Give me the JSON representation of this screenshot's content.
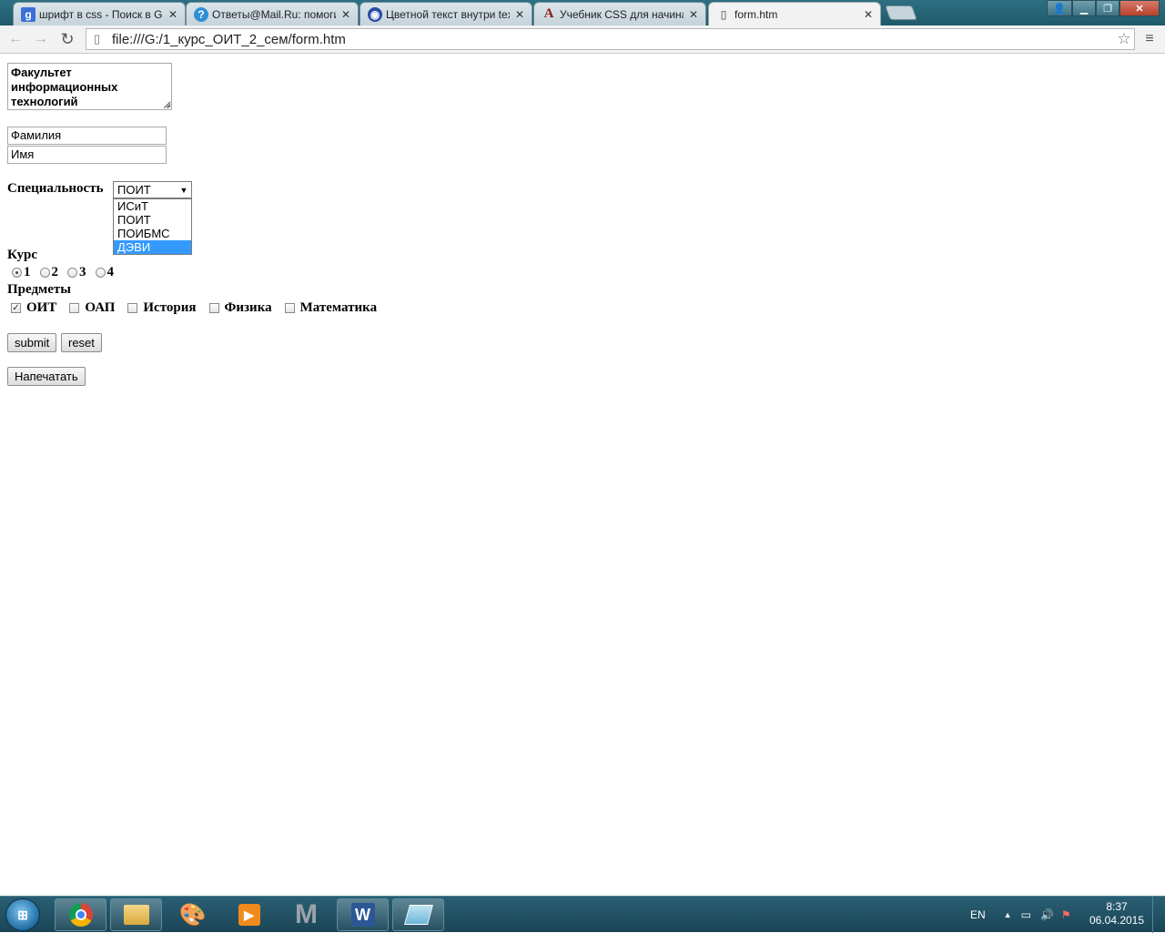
{
  "browser": {
    "tabs": [
      {
        "title": "шрифт в css - Поиск в Go",
        "icon": "google-icon",
        "icon_char": "g",
        "icon_color": "#3b6fd9"
      },
      {
        "title": "Ответы@Mail.Ru: помоги",
        "icon": "question-icon",
        "icon_char": "?",
        "icon_color": "#2f8fd6"
      },
      {
        "title": "Цветной текст внутри tex",
        "icon": "globe-icon",
        "icon_char": "◉",
        "icon_color": "#2a4ca8"
      },
      {
        "title": "Учебник CSS для начина",
        "icon": "letter-a-icon",
        "icon_char": "A",
        "icon_color": "#8b1a1a"
      },
      {
        "title": "form.htm",
        "icon": "page-icon",
        "icon_char": "▯",
        "icon_color": "#888888"
      }
    ],
    "url": "file:///G:/1_курс_ОИТ_2_сем/form.htm"
  },
  "form": {
    "faculty_text": "Факультет информационных технологий",
    "surname_value": "Фамилия",
    "name_value": "Имя",
    "specialty_label": "Специальность",
    "specialty_selected": "ПОИТ",
    "specialty_options": [
      "ИСиТ",
      "ПОИТ",
      "ПОИБМС",
      "ДЭВИ"
    ],
    "specialty_highlighted_index": 3,
    "course_label": "Курс",
    "course_options": [
      "1",
      "2",
      "3",
      "4"
    ],
    "course_selected_index": 0,
    "subjects_label": "Предметы",
    "subjects": [
      {
        "label": "ОИТ",
        "checked": true
      },
      {
        "label": "ОАП",
        "checked": false
      },
      {
        "label": "История",
        "checked": false
      },
      {
        "label": "Физика",
        "checked": false
      },
      {
        "label": "Математика",
        "checked": false
      }
    ],
    "submit_label": "submit",
    "reset_label": "reset",
    "print_label": "Напечатать"
  },
  "taskbar": {
    "language": "EN",
    "time": "8:37",
    "date": "06.04.2015"
  }
}
